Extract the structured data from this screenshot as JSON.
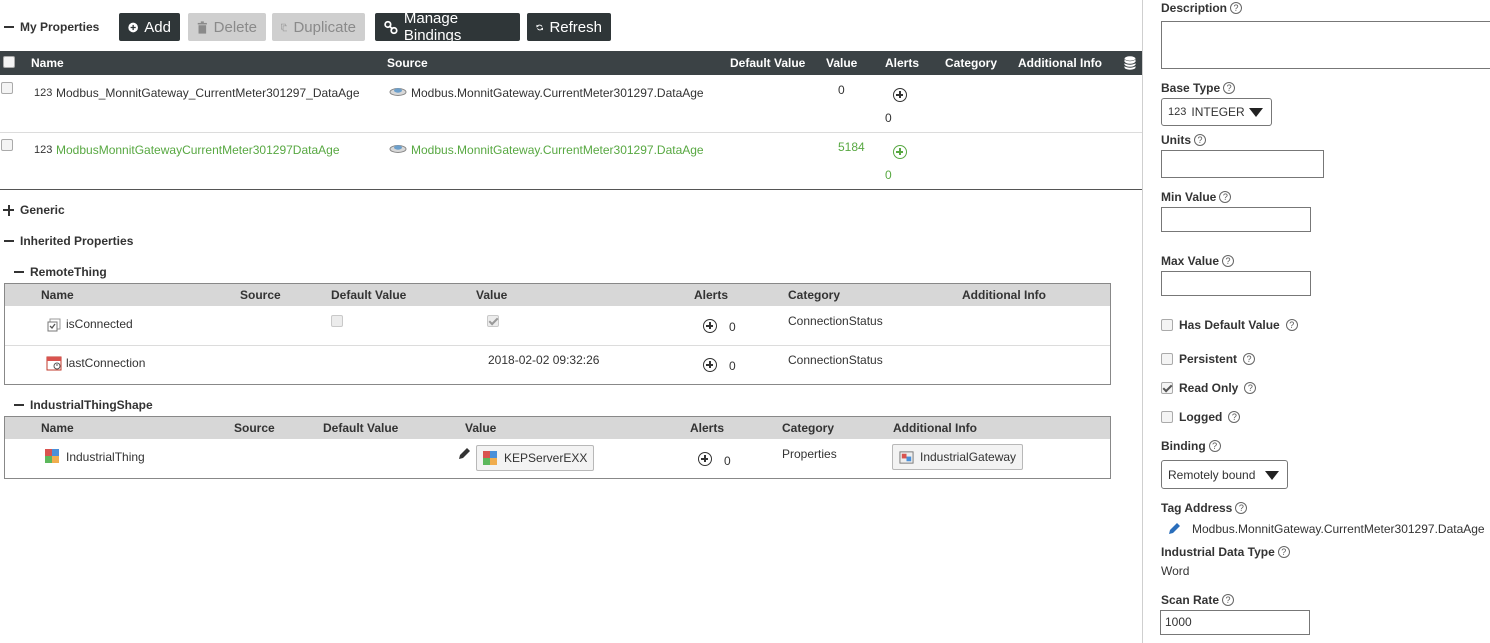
{
  "toolbar": {
    "section_title": "My Properties",
    "add": "Add",
    "delete": "Delete",
    "duplicate": "Duplicate",
    "manage_bindings": "Manage Bindings",
    "refresh": "Refresh"
  },
  "grid": {
    "columns": [
      "Name",
      "Source",
      "Default Value",
      "Value",
      "Alerts",
      "Category",
      "Additional Info"
    ],
    "rows": [
      {
        "type_icon": "123",
        "name": "Modbus_MonnitGateway_CurrentMeter301297_DataAge",
        "source": "Modbus.MonnitGateway.CurrentMeter301297.DataAge",
        "value": "0",
        "alerts": "0"
      },
      {
        "type_icon": "123",
        "name": "ModbusMonnitGatewayCurrentMeter301297DataAge",
        "source": "Modbus.MonnitGateway.CurrentMeter301297.DataAge",
        "value": "5184",
        "alerts": "0"
      }
    ]
  },
  "sections": {
    "generic": "Generic",
    "inherited": "Inherited Properties"
  },
  "remote_thing": {
    "title": "RemoteThing",
    "columns": [
      "Name",
      "Source",
      "Default Value",
      "Value",
      "Alerts",
      "Category",
      "Additional Info"
    ],
    "rows": [
      {
        "name": "isConnected",
        "alerts": "0",
        "category": "ConnectionStatus"
      },
      {
        "name": "lastConnection",
        "value": "2018-02-02 09:32:26",
        "alerts": "0",
        "category": "ConnectionStatus"
      }
    ]
  },
  "industrial_shape": {
    "title": "IndustrialThingShape",
    "columns": [
      "Name",
      "Source",
      "Default Value",
      "Value",
      "Alerts",
      "Category",
      "Additional Info"
    ],
    "rows": [
      {
        "name": "IndustrialThing",
        "value": "KEPServerEXX",
        "alerts": "0",
        "category": "Properties",
        "additional_info": "IndustrialGateway"
      }
    ]
  },
  "panel": {
    "description_label": "Description",
    "base_type_label": "Base Type",
    "base_type_icon": "123",
    "base_type_value": "INTEGER",
    "units_label": "Units",
    "min_label": "Min Value",
    "max_label": "Max Value",
    "has_default_label": "Has Default Value",
    "persistent_label": "Persistent",
    "read_only_label": "Read Only",
    "logged_label": "Logged",
    "binding_label": "Binding",
    "binding_value": "Remotely bound",
    "tag_address_label": "Tag Address",
    "tag_address_value": "Modbus.MonnitGateway.CurrentMeter301297.DataAge",
    "industrial_type_label": "Industrial Data Type",
    "industrial_type_value": "Word",
    "scan_rate_label": "Scan Rate",
    "scan_rate_value": "1000",
    "help_glyph": "?"
  },
  "colors": {
    "header_dark": "#3b4245",
    "button_dark": "#2f3638",
    "bound_green": "#58a842"
  }
}
